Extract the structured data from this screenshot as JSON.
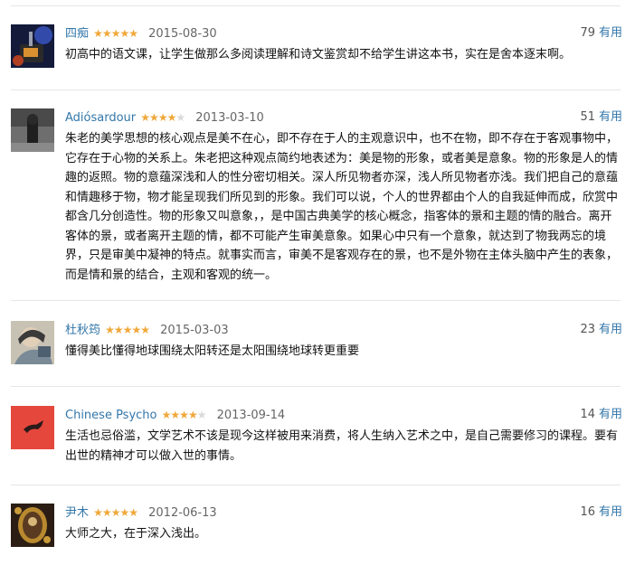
{
  "comments": [
    {
      "author": "四痴",
      "rating": 5,
      "date": "2015-08-30",
      "votes": "79",
      "vote_label": "有用",
      "text": "初高中的语文课，让学生做那么多阅读理解和诗文鉴赏却不给学生讲这本书，实在是舍本逐末啊。"
    },
    {
      "author": "Adiósardour",
      "rating": 4,
      "date": "2013-03-10",
      "votes": "51",
      "vote_label": "有用",
      "text": "朱老的美学思想的核心观点是美不在心，即不存在于人的主观意识中，也不在物，即不存在于客观事物中，它存在于心物的关系上。朱老把这种观点简约地表述为：美是物的形象，或者美是意象。物的形象是人的情趣的返照。物的意蕴深浅和人的性分密切相关。深人所见物者亦深，浅人所见物者亦浅。我们把自己的意蕴和情趣移于物，物才能呈现我们所见到的形象。我们可以说，个人的世界都由个人的自我延伸而成，欣赏中都含几分创造性。物的形象又叫意象，，是中国古典美学的核心概念，指客体的景和主题的情的融合。离开客体的景，或者离开主题的情，都不可能产生审美意象。如果心中只有一个意象，就达到了物我两忘的境界，只是审美中凝神的特点。就事实而言，审美不是客观存在的景，也不是外物在主体头脑中产生的表象，而是情和景的结合，主观和客观的统一。"
    },
    {
      "author": "杜秋筠",
      "rating": 5,
      "date": "2015-03-03",
      "votes": "23",
      "vote_label": "有用",
      "text": "懂得美比懂得地球围绕太阳转还是太阳围绕地球转更重要"
    },
    {
      "author": "Chinese Psycho",
      "rating": 4,
      "date": "2013-09-14",
      "votes": "14",
      "vote_label": "有用",
      "text": "生活也忌俗滥，文学艺术不该是现今这样被用来消费，将人生纳入艺术之中，是自己需要修习的课程。要有出世的精神才可以做入世的事情。"
    },
    {
      "author": "尹木",
      "rating": 5,
      "date": "2012-06-13",
      "votes": "16",
      "vote_label": "有用",
      "text": "大师之大，在于深入浅出。"
    }
  ],
  "colors": {
    "link": "#3377aa",
    "star": "#f0a83a",
    "star_empty": "#d9d9d9",
    "divider": "#e6e6e6"
  },
  "icons": [
    "star-icon",
    "avatar"
  ]
}
